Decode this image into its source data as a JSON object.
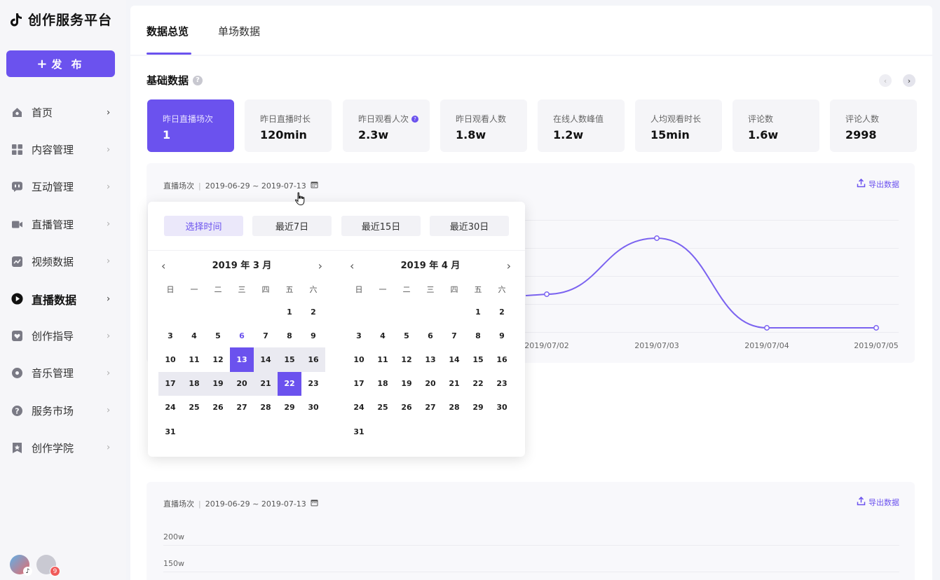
{
  "app": {
    "title": "创作服务平台",
    "publish_label": "发 布"
  },
  "sidebar": {
    "items": [
      {
        "label": "首页",
        "icon": "home-icon"
      },
      {
        "label": "内容管理",
        "icon": "grid-icon"
      },
      {
        "label": "互动管理",
        "icon": "chat-icon"
      },
      {
        "label": "直播管理",
        "icon": "camera-icon"
      },
      {
        "label": "视频数据",
        "icon": "trend-icon"
      },
      {
        "label": "直播数据",
        "icon": "play-icon"
      },
      {
        "label": "创作指导",
        "icon": "heart-icon"
      },
      {
        "label": "音乐管理",
        "icon": "disc-icon"
      },
      {
        "label": "服务市场",
        "icon": "question-icon"
      },
      {
        "label": "创作学院",
        "icon": "star-icon"
      }
    ],
    "badge": "9"
  },
  "tabs": [
    {
      "label": "数据总览"
    },
    {
      "label": "单场数据"
    }
  ],
  "section": {
    "title": "基础数据"
  },
  "stats": [
    {
      "label": "昨日直播场次",
      "value": "1"
    },
    {
      "label": "昨日直播时长",
      "value": "120min"
    },
    {
      "label": "昨日观看人次",
      "value": "2.3w"
    },
    {
      "label": "昨日观看人数",
      "value": "1.8w"
    },
    {
      "label": "在线人数峰值",
      "value": "1.2w"
    },
    {
      "label": "人均观看时长",
      "value": "15min"
    },
    {
      "label": "评论数",
      "value": "1.6w"
    },
    {
      "label": "评论人数",
      "value": "2998"
    }
  ],
  "chart_panel": {
    "metric": "直播场次",
    "separator": "|",
    "date_range": "2019-06-29 ~ 2019-07-13",
    "export_label": "导出数据"
  },
  "chart_data": {
    "type": "line",
    "x": [
      "2019/07/02",
      "2019/07/03",
      "2019/07/04",
      "2019/07/05"
    ],
    "series": [
      {
        "values": [
          0.35,
          0.85,
          0.05,
          0.05
        ]
      }
    ],
    "grid": true,
    "color": "#7b63f0"
  },
  "datepicker": {
    "presets": [
      "选择时间",
      "最近7日",
      "最近15日",
      "最近30日"
    ],
    "weekdays": [
      "日",
      "一",
      "二",
      "三",
      "四",
      "五",
      "六"
    ],
    "left": {
      "title": "2019 年 3 月",
      "rows": [
        [
          "",
          "",
          "",
          "",
          "",
          "1",
          "2"
        ],
        [
          "3",
          "4",
          "5",
          "6",
          "7",
          "8",
          "9"
        ],
        [
          "10",
          "11",
          "12",
          "13",
          "14",
          "15",
          "16"
        ],
        [
          "17",
          "18",
          "19",
          "20",
          "21",
          "22",
          "23"
        ],
        [
          "24",
          "25",
          "26",
          "27",
          "28",
          "29",
          "30"
        ],
        [
          "31",
          "",
          "",
          "",
          "",
          "",
          ""
        ]
      ]
    },
    "right": {
      "title": "2019 年 4 月",
      "rows": [
        [
          "",
          "",
          "",
          "",
          "",
          "1",
          "2"
        ],
        [
          "3",
          "4",
          "5",
          "6",
          "7",
          "8",
          "9"
        ],
        [
          "10",
          "11",
          "12",
          "13",
          "14",
          "15",
          "16"
        ],
        [
          "17",
          "18",
          "19",
          "20",
          "21",
          "22",
          "23"
        ],
        [
          "24",
          "25",
          "26",
          "27",
          "28",
          "29",
          "30"
        ],
        [
          "31",
          "",
          "",
          "",
          "",
          "",
          ""
        ]
      ]
    },
    "range_start": "13",
    "range_end": "22",
    "highlight": "6"
  },
  "second_panel": {
    "metric": "直播场次",
    "separator": "|",
    "date_range": "2019-06-29 ~ 2019-07-13",
    "export_label": "导出数据",
    "y_ticks": [
      "200w",
      "150w"
    ]
  },
  "colors": {
    "accent": "#6b52ee"
  }
}
